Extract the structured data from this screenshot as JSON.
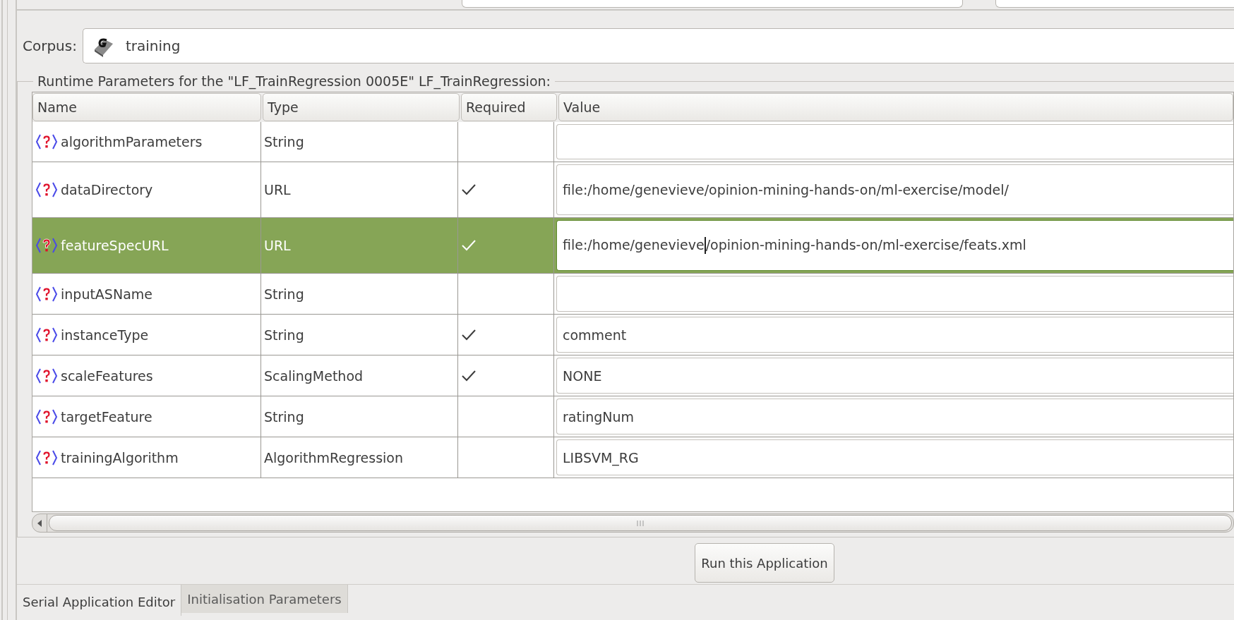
{
  "corpus": {
    "label": "Corpus:",
    "value": "training"
  },
  "parameters": {
    "title": "Runtime Parameters for the \"LF_TrainRegression 0005E\" LF_TrainRegression:",
    "columns": [
      "Name",
      "Type",
      "Required",
      "Value"
    ],
    "rows": [
      {
        "name": "algorithmParameters",
        "type": "String",
        "required": false,
        "selected": false
      },
      {
        "name": "dataDirectory",
        "type": "URL",
        "required": true,
        "value": "file:/home/genevieve/opinion-mining-hands-on/ml-exercise/model/",
        "selected": false
      },
      {
        "name": "featureSpecURL",
        "type": "URL",
        "required": true,
        "value": "file:/home/genevieve/opinion-mining-hands-on/ml-exercise/feats.xml",
        "selected": true
      },
      {
        "name": "inputASName",
        "type": "String",
        "required": false,
        "selected": false
      },
      {
        "name": "instanceType",
        "type": "String",
        "required": true,
        "value": "comment",
        "selected": false
      },
      {
        "name": "scaleFeatures",
        "type": "ScalingMethod",
        "required": true,
        "value": "NONE",
        "selected": false
      },
      {
        "name": "targetFeature",
        "type": "String",
        "required": false,
        "value": "ratingNum",
        "selected": false
      },
      {
        "name": "trainingAlgorithm",
        "type": "AlgorithmRegression",
        "required": false,
        "value": "LIBSVM_RG",
        "selected": false
      }
    ]
  },
  "run_button": "Run this Application",
  "tabs": [
    {
      "label": "Serial Application Editor",
      "selected": true
    },
    {
      "label": "Initialisation Parameters",
      "selected": false
    }
  ]
}
